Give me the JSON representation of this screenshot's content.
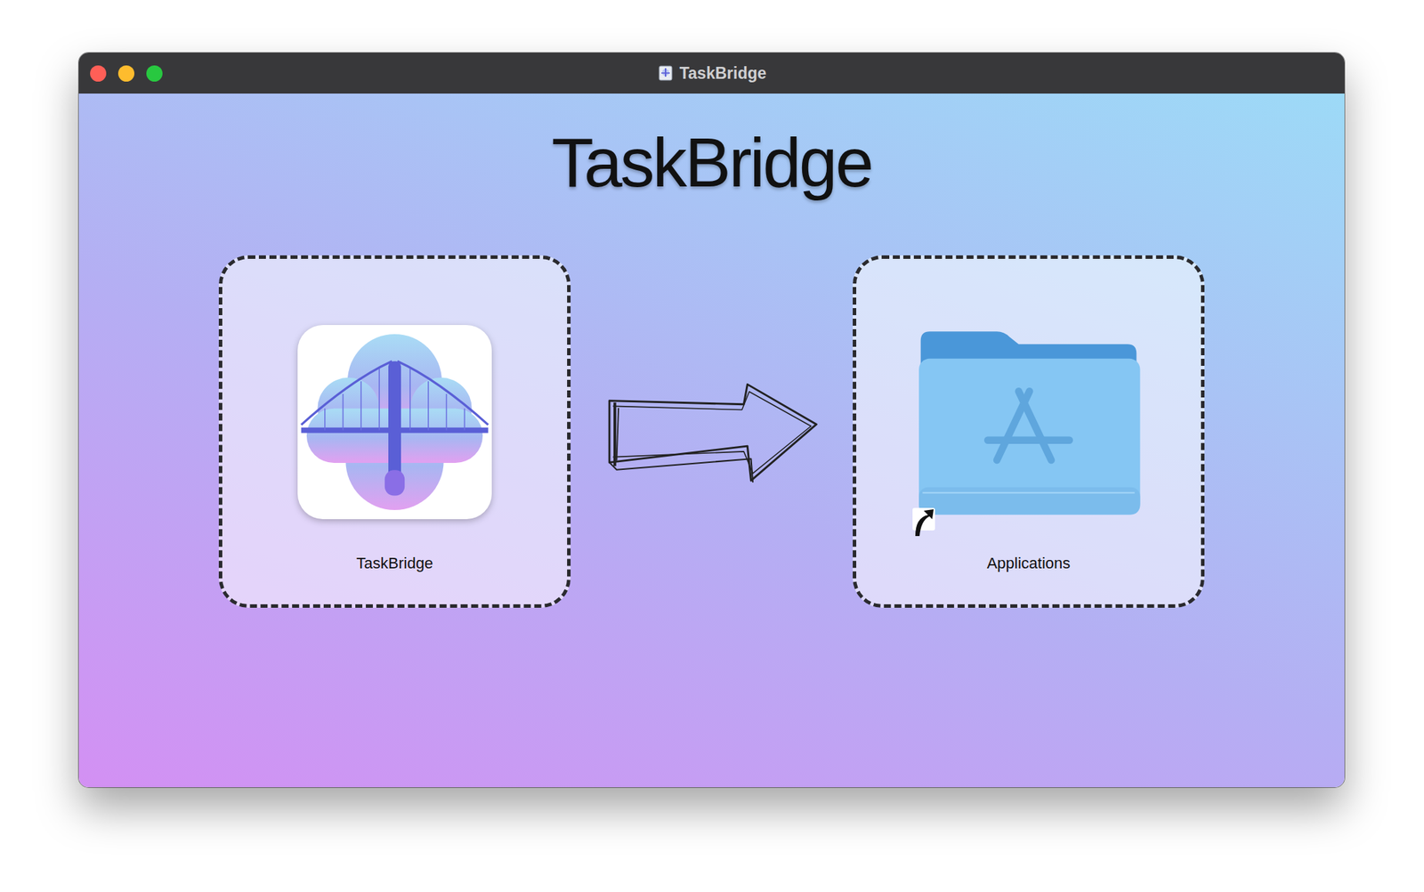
{
  "window": {
    "title": "TaskBridge"
  },
  "heading": "TaskBridge",
  "items": [
    {
      "label": "TaskBridge",
      "kind": "app"
    },
    {
      "label": "Applications",
      "kind": "folder"
    }
  ]
}
